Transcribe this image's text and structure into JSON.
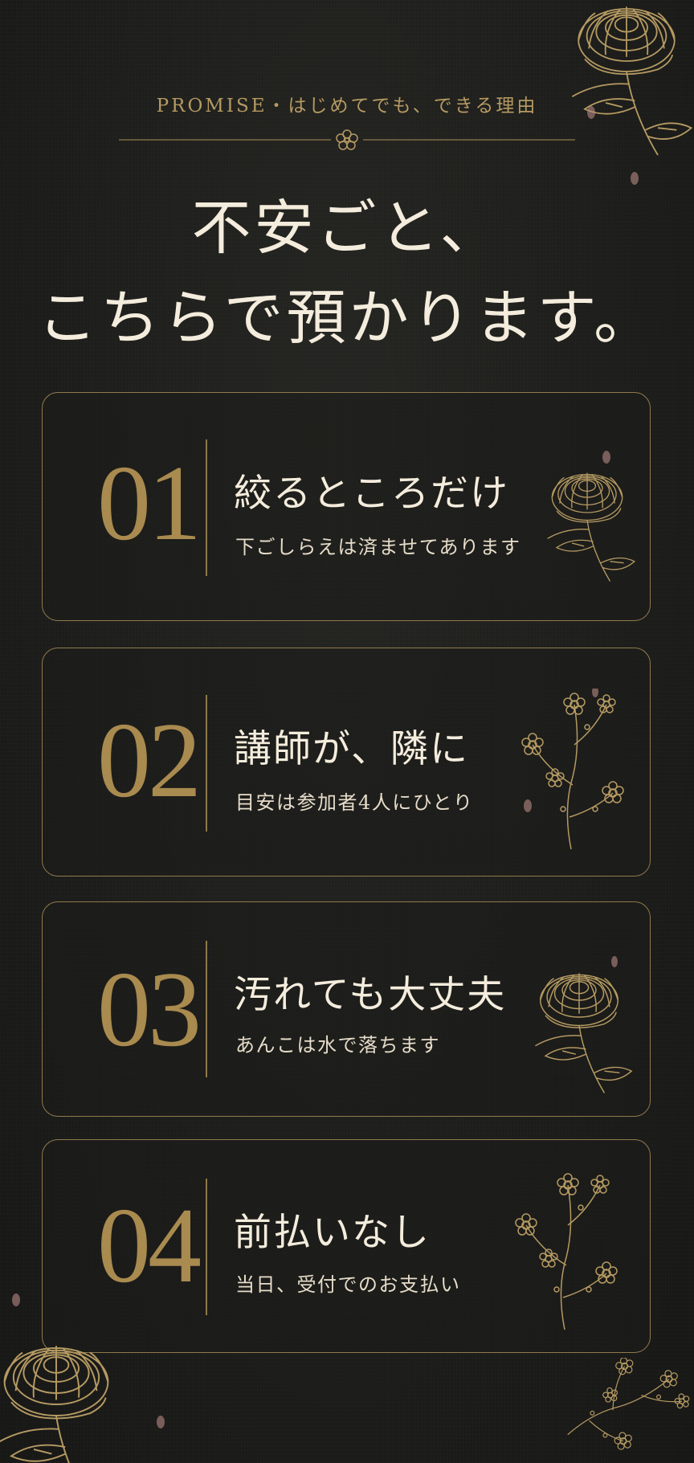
{
  "header": {
    "eyebrow": "PROMISE・はじめてでも、できる理由",
    "headline_line1": "不安ごと、",
    "headline_line2": "こちらで預かります。"
  },
  "cards": [
    {
      "number": "01",
      "title": "絞るところだけ",
      "subtitle": "下ごしらえは済ませてあります",
      "art": "chrysanthemum-icon"
    },
    {
      "number": "02",
      "title": "講師が、隣に",
      "subtitle": "目安は参加者4人にひとり",
      "art": "plum-blossom-branch-icon"
    },
    {
      "number": "03",
      "title": "汚れても大丈夫",
      "subtitle": "あんこは水で落ちます",
      "art": "chrysanthemum-icon"
    },
    {
      "number": "04",
      "title": "前払いなし",
      "subtitle": "当日、受付でのお支払い",
      "art": "plum-blossom-branch-icon"
    }
  ],
  "colors": {
    "background": "#1c1c1a",
    "gold": "#a98a4f",
    "gold_line": "#8f7a4c",
    "text": "#f4ecdc",
    "petal": "#b88a85"
  }
}
